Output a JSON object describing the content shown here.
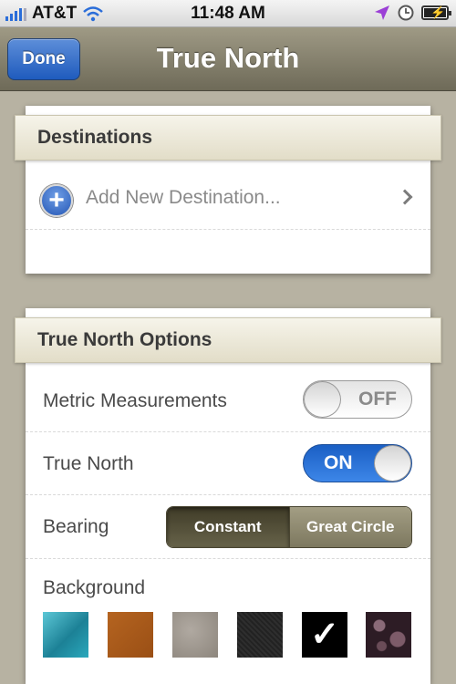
{
  "status_bar": {
    "carrier": "AT&T",
    "time": "11:48 AM",
    "icons": [
      "signal-bars-icon",
      "wifi-icon",
      "location-arrow-icon",
      "clock-icon",
      "battery-icon"
    ]
  },
  "nav_bar": {
    "title": "True North",
    "done_label": "Done"
  },
  "destinations": {
    "header": "Destinations",
    "add_label": "Add New Destination..."
  },
  "options": {
    "header": "True North Options",
    "metric": {
      "label": "Metric Measurements",
      "state": "OFF"
    },
    "true_north": {
      "label": "True North",
      "state": "ON"
    },
    "bearing": {
      "label": "Bearing",
      "segments": [
        "Constant",
        "Great Circle"
      ],
      "selected": "Constant"
    },
    "background": {
      "label": "Background",
      "swatches": [
        {
          "name": "teal-texture",
          "color": "#2a9fb3",
          "selected": false
        },
        {
          "name": "orange-leather",
          "color": "#a8591c",
          "selected": false
        },
        {
          "name": "gray-stone",
          "color": "#9d968d",
          "selected": false
        },
        {
          "name": "dark-carbon",
          "color": "#2a2a2a",
          "selected": false
        },
        {
          "name": "black",
          "color": "#000000",
          "selected": true
        },
        {
          "name": "bokeh-purple",
          "color": "#3a2430",
          "selected": false
        }
      ]
    }
  },
  "colors": {
    "nav_accent": "#1f5bbd",
    "switch_on": "#2f7be0",
    "location_arrow": "#9b3fd6"
  }
}
